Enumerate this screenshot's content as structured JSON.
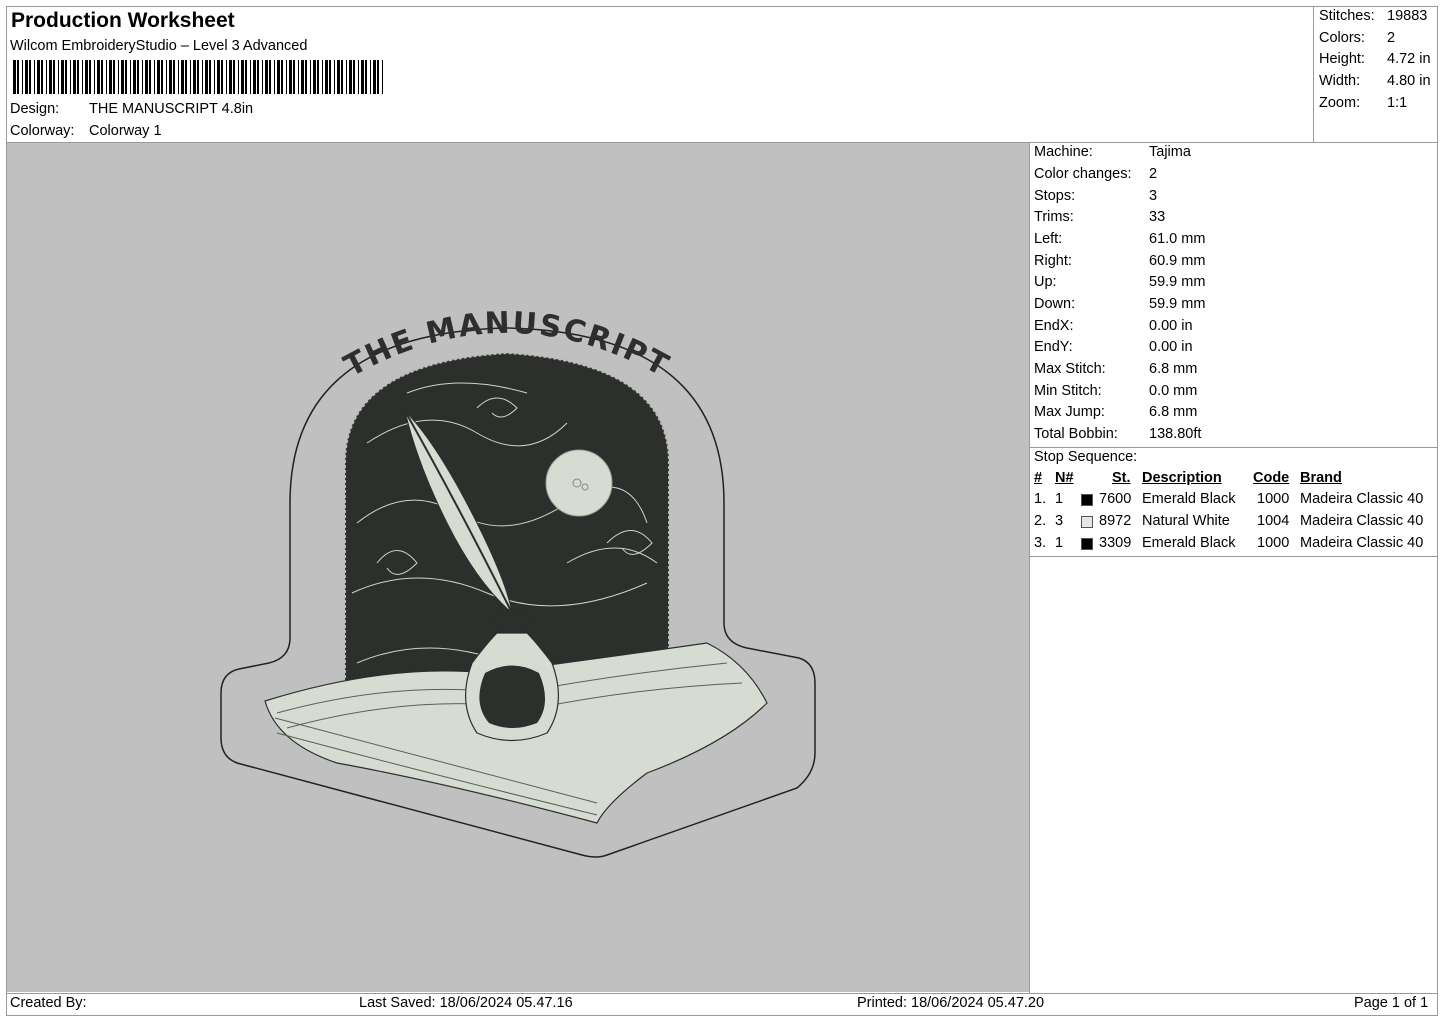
{
  "header": {
    "title": "Production Worksheet",
    "subtitle": "Wilcom EmbroideryStudio – Level 3 Advanced",
    "design_label": "Design:",
    "design_value": "THE MANUSCRIPT 4.8in",
    "colorway_label": "Colorway:",
    "colorway_value": "Colorway 1"
  },
  "summary": [
    {
      "label": "Stitches:",
      "value": "19883"
    },
    {
      "label": "Colors:",
      "value": "2"
    },
    {
      "label": "Height:",
      "value": "4.72 in"
    },
    {
      "label": "Width:",
      "value": "4.80 in"
    },
    {
      "label": "Zoom:",
      "value": "1:1"
    }
  ],
  "preview": {
    "design_text": "THE MANUSCRIPT",
    "background_color": "#c0c0c0",
    "thread_dark": "#2c2f2c",
    "thread_light": "#d6dcd2"
  },
  "machine_info": [
    {
      "label": "Machine:",
      "value": "Tajima"
    },
    {
      "label": "Color changes:",
      "value": "2"
    },
    {
      "label": "Stops:",
      "value": "3"
    },
    {
      "label": "Trims:",
      "value": "33"
    },
    {
      "label": "Left:",
      "value": "61.0 mm"
    },
    {
      "label": "Right:",
      "value": "60.9 mm"
    },
    {
      "label": "Up:",
      "value": "59.9 mm"
    },
    {
      "label": "Down:",
      "value": "59.9 mm"
    },
    {
      "label": "EndX:",
      "value": "0.00 in"
    },
    {
      "label": "EndY:",
      "value": "0.00 in"
    },
    {
      "label": "Max Stitch:",
      "value": "6.8 mm"
    },
    {
      "label": "Min Stitch:",
      "value": "0.0 mm"
    },
    {
      "label": "Max Jump:",
      "value": "6.8 mm"
    },
    {
      "label": "Total Bobbin:",
      "value": "138.80ft"
    }
  ],
  "stop_sequence": {
    "title": "Stop Sequence:",
    "columns": {
      "num": "#",
      "needle": "N#",
      "st": "St.",
      "description": "Description",
      "code": "Code",
      "brand": "Brand"
    },
    "rows": [
      {
        "num": "1.",
        "needle": "1",
        "color": "#000000",
        "st": "7600",
        "description": "Emerald Black",
        "code": "1000",
        "brand": "Madeira Classic 40"
      },
      {
        "num": "2.",
        "needle": "3",
        "color": "#e6e6e6",
        "st": "8972",
        "description": "Natural White",
        "code": "1004",
        "brand": "Madeira Classic 40"
      },
      {
        "num": "3.",
        "needle": "1",
        "color": "#000000",
        "st": "3309",
        "description": "Emerald Black",
        "code": "1000",
        "brand": "Madeira Classic 40"
      }
    ]
  },
  "footer": {
    "created_by": "Created By:",
    "last_saved": "Last Saved: 18/06/2024 05.47.16",
    "printed": "Printed: 18/06/2024 05.47.20",
    "page": "Page 1 of 1"
  }
}
